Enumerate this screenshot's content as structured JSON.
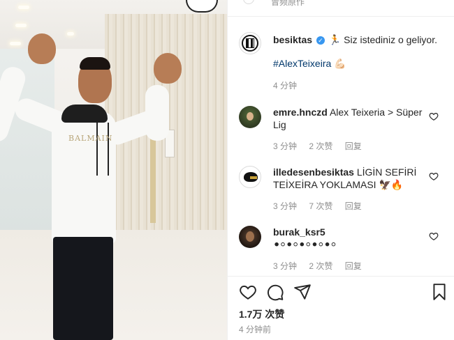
{
  "post": {
    "username": "besiktas",
    "caption_text": "🏃 Siz istediniz o geliyor.",
    "hashtag": "#AlexTeixeira 💪🏻",
    "time": "4 分钟",
    "photo_print_text": "BALMAIN",
    "top_cut_text": "曾频原作"
  },
  "comments": [
    {
      "username": "emre.hnczd",
      "text": "Alex Teixeria > Süper Lig",
      "time": "3 分钟",
      "likes": "2 次赞",
      "reply": "回复",
      "avatar_icon": "user-avatar"
    },
    {
      "username": "illedesenbesiktas",
      "text": "LİGİN SEFİRİ TEİXEİRA YOKLAMASI 🦅🔥",
      "time": "3 分钟",
      "likes": "7 次赞",
      "reply": "回复",
      "avatar_icon": "eagle-avatar"
    },
    {
      "username": "burak_ksr5",
      "text": "⚫⚪⚫⚪⚫⚪⚫⚪⚫⚪",
      "time": "3 分钟",
      "likes": "2 次赞",
      "reply": "回复",
      "avatar_icon": "user-avatar"
    }
  ],
  "footer": {
    "likes_count": "1.7万 次赞",
    "time_ago": "4 分钟前"
  },
  "icons": {
    "like": "heart-icon",
    "comment": "comment-icon",
    "share": "share-icon",
    "save": "bookmark-icon",
    "comment_like": "heart-icon",
    "verified": "verified-badge-icon"
  },
  "colors": {
    "text": "#262626",
    "secondary": "#8e8e8e",
    "hashtag": "#00376b",
    "verified": "#3897f0"
  }
}
